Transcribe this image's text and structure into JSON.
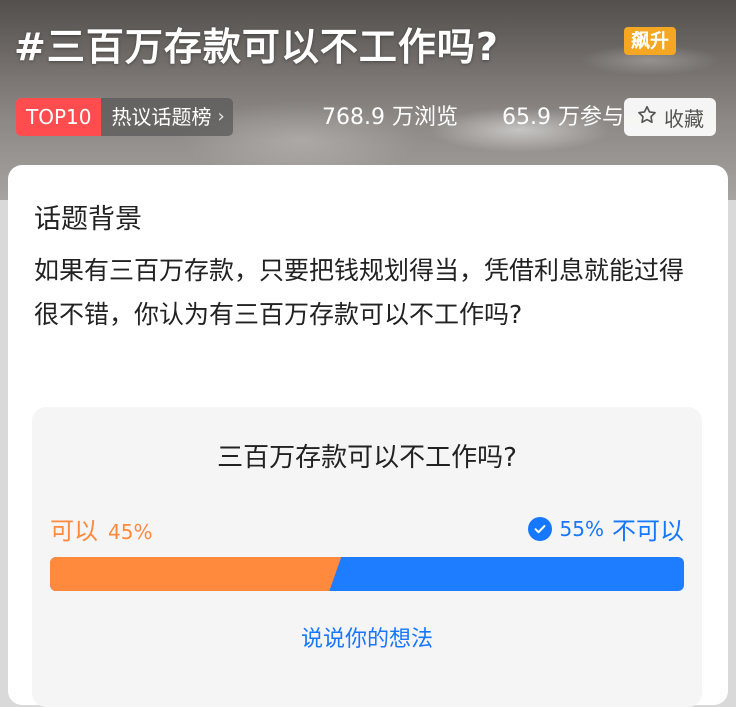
{
  "header": {
    "title": "#三百万存款可以不工作吗?",
    "hot_badge": "飙升",
    "rank_badge": "TOP10",
    "rank_list": "热议话题榜",
    "views": "768.9 万浏览",
    "participants": "65.9 万参与",
    "favorite_label": "收藏"
  },
  "background": {
    "title": "话题背景",
    "text": "如果有三百万存款，只要把钱规划得当，凭借利息就能过得很不错，你认为有三百万存款可以不工作吗?"
  },
  "poll": {
    "question": "三百万存款可以不工作吗?",
    "option_a": {
      "label": "可以",
      "percent_text": "45%",
      "percent": 45,
      "color": "#ff8a3d"
    },
    "option_b": {
      "label": "不可以",
      "percent_text": "55%",
      "percent": 55,
      "color": "#1e7cff",
      "selected": true
    },
    "cta": "说说你的想法"
  },
  "icons": {
    "favorite": "star-outline-icon",
    "chevron": "chevron-right-icon",
    "selected": "check-circle-icon"
  }
}
